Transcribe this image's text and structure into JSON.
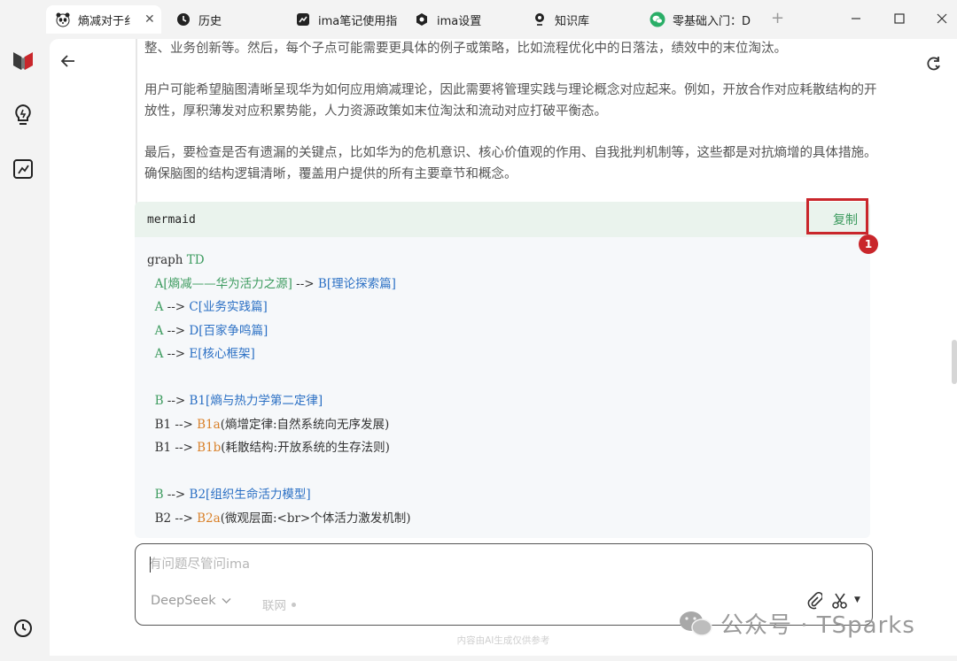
{
  "tabs": [
    {
      "label": "熵减对于纟",
      "icon": "panda-icon",
      "active": true
    },
    {
      "label": "历史",
      "icon": "history-icon"
    },
    {
      "label": "ima笔记使用指",
      "icon": "note-icon"
    },
    {
      "label": "ima设置",
      "icon": "settings-hex-icon"
    },
    {
      "label": "知识库",
      "icon": "knowledge-pin-icon"
    },
    {
      "label": "零基础入门：D",
      "icon": "wechat-icon"
    }
  ],
  "new_tab": "+",
  "window_controls": {
    "minimize": "minimize-icon",
    "maximize": "maximize-icon",
    "close": "close-icon"
  },
  "sidebar": {
    "items": [
      "app-logo",
      "lightbulb-icon",
      "edit-note-icon",
      "history-clock-icon"
    ]
  },
  "answer_paragraphs": [
    "整、业务创新等。然后，每个子点可能需要更具体的例子或策略，比如流程优化中的日落法，绩效中的末位淘汰。",
    "用户可能希望脑图清晰呈现华为如何应用熵减理论，因此需要将管理实践与理论概念对应起来。例如，开放合作对应耗散结构的开放性，厚积薄发对应积累势能，人力资源政策如末位淘汰和流动对应打破平衡态。",
    "最后，要检查是否有遗漏的关键点，比如华为的危机意识、核心价值观的作用、自我批判机制等，这些都是对抗熵增的具体措施。确保脑图的结构逻辑清晰，覆盖用户提供的所有主要章节和概念。"
  ],
  "code_block": {
    "language": "mermaid",
    "copy_label": "复制",
    "lines": [
      [
        {
          "t": "graph ",
          "c": ""
        },
        {
          "t": "TD",
          "c": "kw"
        }
      ],
      [
        {
          "t": "  A[熵减——华为活力之源]",
          "c": "kw"
        },
        {
          "t": " --> ",
          "c": ""
        },
        {
          "t": "B[理论探索篇]",
          "c": "node"
        }
      ],
      [
        {
          "t": "  A",
          "c": "kw"
        },
        {
          "t": " --> ",
          "c": ""
        },
        {
          "t": "C[业务实践篇]",
          "c": "node"
        }
      ],
      [
        {
          "t": "  A",
          "c": "kw"
        },
        {
          "t": " --> ",
          "c": ""
        },
        {
          "t": "D[百家争鸣篇]",
          "c": "node"
        }
      ],
      [
        {
          "t": "  A",
          "c": "kw"
        },
        {
          "t": " --> ",
          "c": ""
        },
        {
          "t": "E[核心框架]",
          "c": "node"
        }
      ],
      [
        {
          "t": "",
          "c": ""
        }
      ],
      [
        {
          "t": "  B",
          "c": "kw"
        },
        {
          "t": " --> ",
          "c": ""
        },
        {
          "t": "B1[熵与热力学第二定律]",
          "c": "node"
        }
      ],
      [
        {
          "t": "  B1",
          "c": ""
        },
        {
          "t": " --> ",
          "c": ""
        },
        {
          "t": "B1a",
          "c": "leaf"
        },
        {
          "t": "(熵增定律:自然系统向无序发展)",
          "c": ""
        }
      ],
      [
        {
          "t": "  B1",
          "c": ""
        },
        {
          "t": " --> ",
          "c": ""
        },
        {
          "t": "B1b",
          "c": "leaf"
        },
        {
          "t": "(耗散结构:开放系统的生存法则)",
          "c": ""
        }
      ],
      [
        {
          "t": "",
          "c": ""
        }
      ],
      [
        {
          "t": "  B",
          "c": "kw"
        },
        {
          "t": " --> ",
          "c": ""
        },
        {
          "t": "B2[组织生命活力模型]",
          "c": "node"
        }
      ],
      [
        {
          "t": "  B2",
          "c": ""
        },
        {
          "t": " --> ",
          "c": ""
        },
        {
          "t": "B2a",
          "c": "leaf"
        },
        {
          "t": "(微观层面:<br>个体活力激发机制)",
          "c": ""
        }
      ]
    ]
  },
  "annotation": {
    "badge": "1"
  },
  "composer": {
    "placeholder": "有问题尽管问ima",
    "value": "",
    "model": "DeepSeek",
    "web_toggle": "联网",
    "disclaimer": "内容由AI生成仅供参考"
  },
  "watermark": {
    "text": "公众号 · TSparks"
  }
}
